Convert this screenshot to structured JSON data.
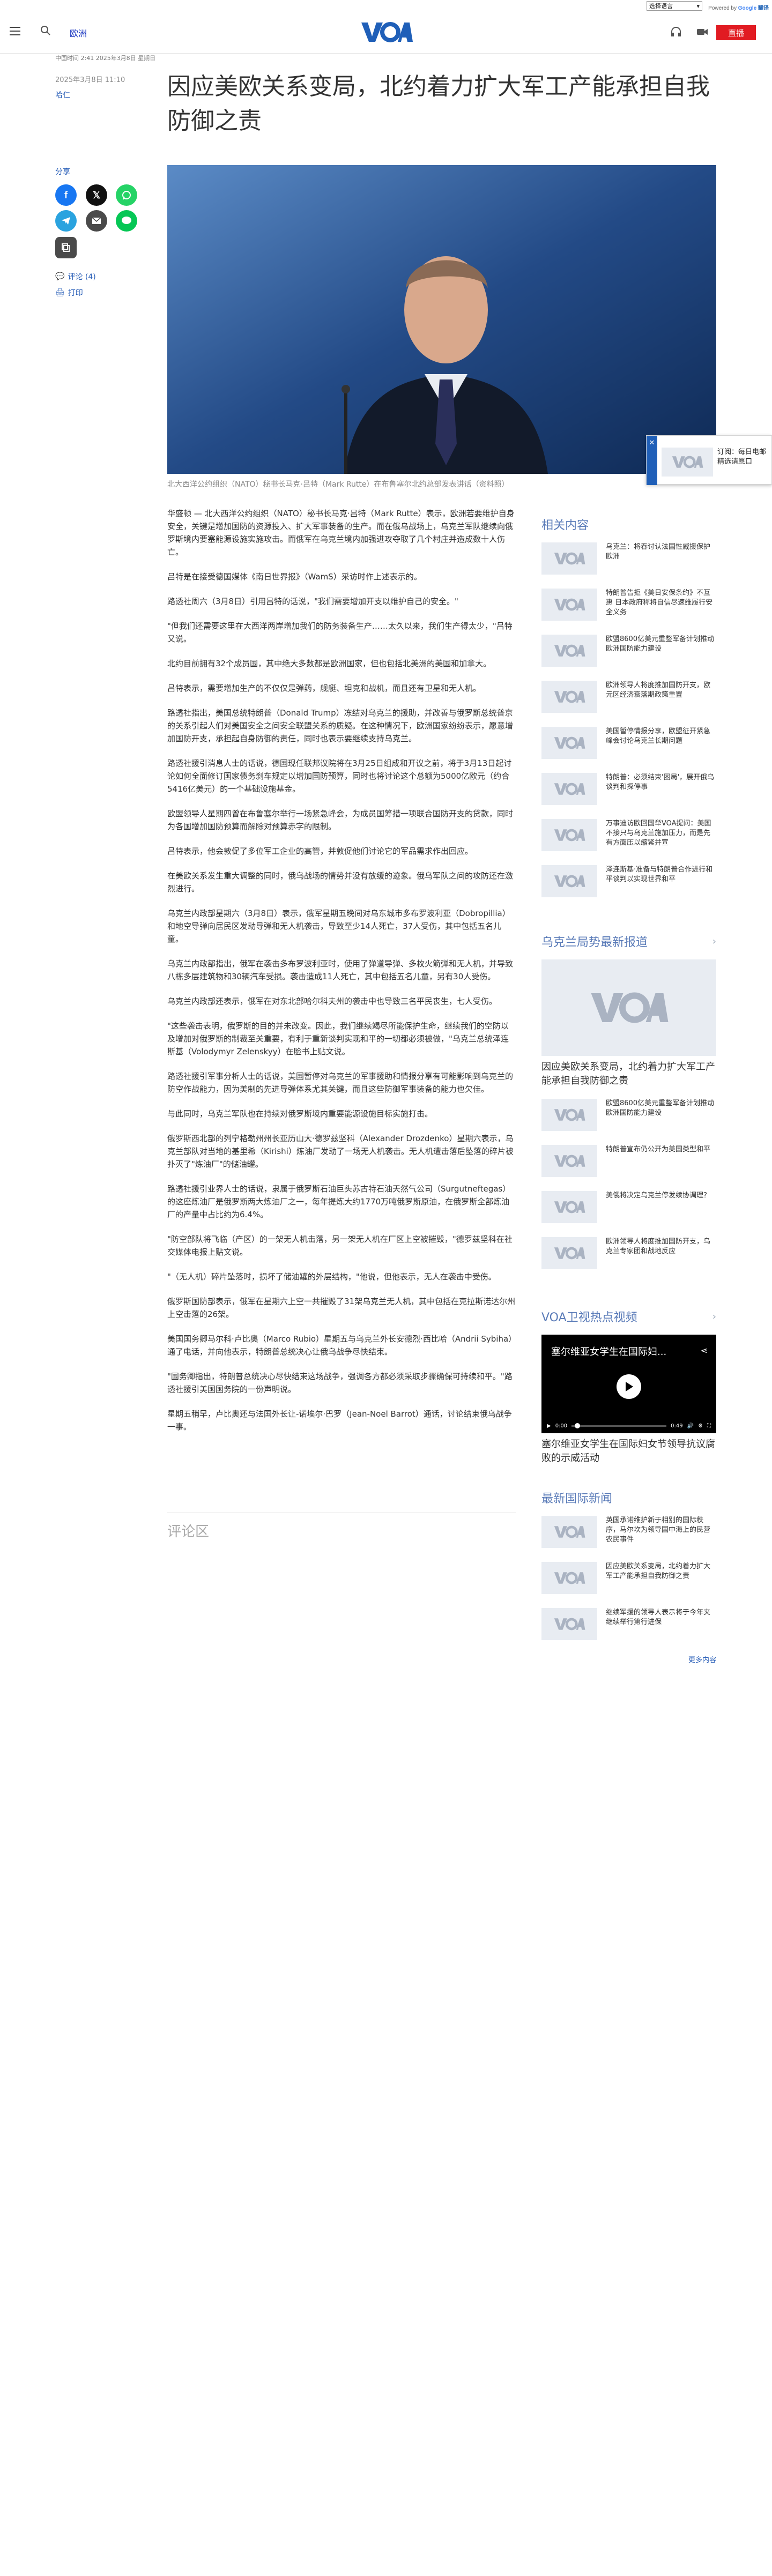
{
  "translate": {
    "select_label": "选择语言",
    "powered": "Powered by",
    "google": "Google",
    "translate": "翻译"
  },
  "header": {
    "section": "欧洲",
    "live_label": "直播"
  },
  "article": {
    "meta": "中国时间 2:41 2025年3月8日 星期日",
    "date": "2025年3月8日 11:10",
    "author": "哈仁",
    "title": "因应美欧关系变局，北约着力扩大军工产能承担自我防御之责",
    "caption": "北大西洋公约组织（NATO）秘书长马克·吕特（Mark Rutte）在布鲁塞尔北约总部发表讲话（资料照）",
    "paragraphs": [
      "华盛顿 — 北大西洋公约组织（NATO）秘书长马克·吕特（Mark Rutte）表示，欧洲若要维护自身安全，关键是增加国防的资源投入、扩大军事装备的生产。而在俄乌战场上，乌克兰军队继续向俄罗斯境内要塞能源设施实施攻击。而俄军在乌克兰境内加强进攻夺取了几个村庄并造成数十人伤亡。",
      "吕特是在接受德国媒体《南日世界报》（WamS）采访时作上述表示的。",
      "路透社周六（3月8日）引用吕特的话说，\"我们需要增加开支以维护自己的安全。\"",
      "\"但我们还需要这里在大西洋两岸增加我们的防务装备生产……太久以来，我们生产得太少，\"吕特又说。",
      "北约目前拥有32个成员国，其中绝大多数都是欧洲国家，但也包括北美洲的美国和加拿大。",
      "吕特表示，需要增加生产的不仅仅是弹药，舰艇、坦克和战机，而且还有卫星和无人机。",
      "路透社指出，美国总统特朗普（Donald Trump）冻结对乌克兰的援助，并改善与俄罗斯总统普京的关系引起人们对美国安全之间安全联盟关系的质疑。在这种情况下，欧洲国家纷纷表示，愿意增加国防开支，承担起自身防御的责任，同时也表示要继续支持乌克兰。",
      "路透社援引消息人士的话说，德国现任联邦议院将在3月25日组成和开议之前，将于3月13日起讨论如何全面修订国家债务刹车规定以增加国防预算，同时也将讨论这个总额为5000亿欧元（约合5416亿美元）的一个基础设施基金。",
      "欧盟领导人星期四曾在布鲁塞尔举行一场紧急峰会，为成员国筹措一项联合国防开支的贷款，同时为各国增加国防预算而解除对预算赤字的限制。",
      "吕特表示，他会敦促了多位军工企业的高管，并敦促他们讨论它的军品需求作出回应。",
      "在美欧关系发生重大调整的同时，俄乌战场的情势并没有放缓的迹象。俄乌军队之间的攻防还在激烈进行。",
      "乌克兰内政部星期六（3月8日）表示，俄军星期五晚间对乌东城市多布罗波利亚（Dobropillia）和地空导弹向居民区发动导弹和无人机袭击，导致至少14人死亡，37人受伤，其中包括五名儿童。",
      "乌克兰内政部指出，俄军在袭击多布罗波利亚时，使用了弹道导弹、多枚火箭弹和无人机，并导致八栋多层建筑物和30辆汽车受损。袭击造成11人死亡，其中包括五名儿童，另有30人受伤。",
      "乌克兰内政部还表示，俄军在对东北部哈尔科夫州的袭击中也导致三名平民丧生，七人受伤。",
      "\"这些袭击表明，俄罗斯的目的并未改变。因此，我们继续竭尽所能保护生命，继续我们的空防以及增加对俄罗斯的制裁至关重要，有利于重新谈判实现和平的一切都必须被做，\"乌克兰总统泽连斯基（Volodymyr Zelenskyy）在脸书上贴文说。",
      "路透社援引军事分析人士的话说，美国暂停对乌克兰的军事援助和情报分享有可能影响到乌克兰的防空作战能力，因为美制的先进导弹体系尤其关键，而且这些防御军事装备的能力也欠佳。",
      "与此同时，乌克兰军队也在持续对俄罗斯境内重要能源设施目标实施打击。",
      "俄罗斯西北部的列宁格勒州州长亚历山大·德罗兹坚科（Alexander Drozdenko）星期六表示，乌克兰部队对当地的基里希（Kirishi）炼油厂发动了一场无人机袭击。无人机遭击落后坠落的碎片被扑灭了\"炼油厂\"的储油罐。",
      "路透社援引业界人士的话说，隶属于俄罗斯石油巨头苏古特石油天然气公司（Surgutneftegas）的这座炼油厂是俄罗斯两大炼油厂之一，每年提炼大约1770万吨俄罗斯原油，在俄罗斯全部炼油厂的产量中占比约为6.4%。",
      "\"防空部队将飞临（产区）的一架无人机击落，另一架无人机在厂区上空被摧毁，\"德罗兹坚科在社交媒体电报上贴文说。",
      "\"（无人机）碎片坠落时，损坏了储油罐的外层结构，\"他说，但他表示，无人在袭击中受伤。",
      "俄罗斯国防部表示，俄军在星期六上空一共摧毁了31架乌克兰无人机，其中包括在克拉斯诺达尔州上空击落的26架。",
      "美国国务卿马尔科·卢比奥（Marco Rubio）星期五与乌克兰外长安德烈·西比哈（Andrii Sybiha）通了电话，并向他表示，特朗普总统决心让俄乌战争尽快结束。",
      "\"国务卿指出，特朗普总统决心尽快结束这场战争，强调各方都必须采取步骤确保可持续和平。\"路透社援引美国国务院的一份声明说。",
      "星期五稍早，卢比奥还与法国外长让-诺埃尔·巴罗（Jean-Noel Barrot）通话，讨论结束俄乌战争一事。"
    ],
    "comments_label": "评论区"
  },
  "share": {
    "label": "分享",
    "comment_link": "评论 (4)",
    "print_link": "打印"
  },
  "sticky": {
    "text": "订阅：每日电邮精选请愿口"
  },
  "related": {
    "heading": "相关内容",
    "items": [
      "乌克兰：将吞讨认法国性威援保护欧洲",
      "特朗普告拒《美日安保条约》不互惠 日本政府称将自信尽速维履行安全义务",
      "欧盟8600亿美元重整军备计划推动欧洲国防能力建设",
      "欧洲领导人将度推加国防开支，欧元区经济衰落期政策重置",
      "美国暂停情报分享，欧盟征开紧急峰会讨论乌克兰长期问题",
      "特朗普：必须结束'困局'，展开俄乌谈判和探停事",
      "万事迪访欧回国举VOA提问：美国不接只与乌克兰施加压力，而是先有方面压以缩紧并宣",
      "泽连斯基·准备与特朗普合作进行和平谈判以实现世界和平"
    ]
  },
  "ukraine": {
    "heading": "乌克兰局势最新报道",
    "big_title": "因应美欧关系变局，北约着力扩大军工产能承担自我防御之责",
    "items": [
      "欧盟8600亿美元重整军备计划推动欧洲国防能力建设",
      "特朗普宣布仍公开为美国类型和平",
      "美俄将决定乌克兰停发续协调理？",
      "欧洲领导人将度推加国防开支，乌克兰专家团和战地反应"
    ]
  },
  "video": {
    "heading": "VOA卫视热点视频",
    "title": "塞尔维亚女学生在国际妇...",
    "time_current": "0:00",
    "time_total": "0:49",
    "caption": "塞尔维亚女学生在国际妇女节领导抗议腐败的示威活动"
  },
  "intl": {
    "heading": "最新国际新闻",
    "items": [
      "英国承诺维护新于相别的国际秩序，马尔坎为领导国中海上的民营农民事件",
      "因应美欧关系变局，北约着力扩大军工产能承担自我防御之责",
      "继续军援的领导人表示将于今年夹继续举行第行进保"
    ],
    "more": "更多内容"
  },
  "icons": {
    "menu": "hamburger-icon",
    "search": "search-icon",
    "logo": "voa-logo",
    "brand_red": "#e11b22",
    "link_blue": "#2a5fb8"
  }
}
